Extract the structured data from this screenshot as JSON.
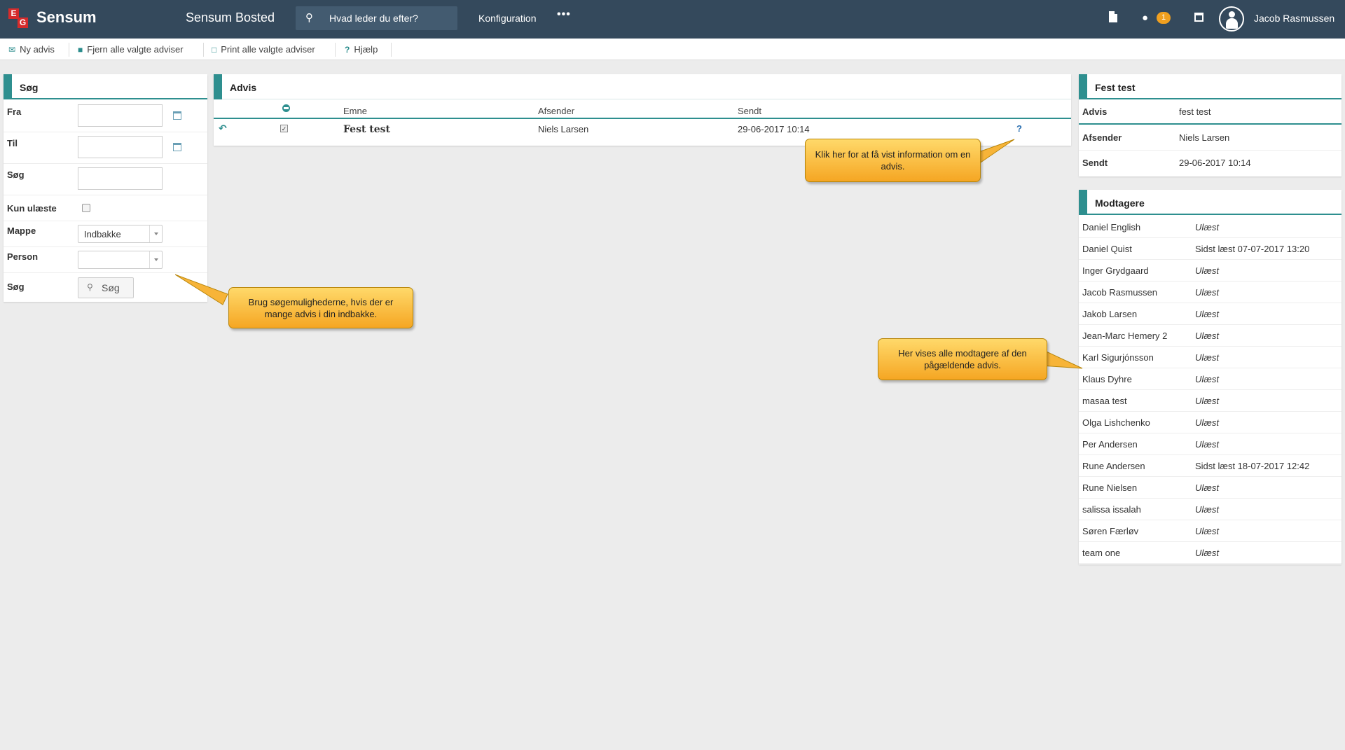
{
  "topbar": {
    "brand": "Sensum",
    "product": "Sensum Bosted",
    "search_placeholder": "Hvad leder du efter?",
    "nav_configuration": "Konfiguration",
    "nav_more": "•••",
    "chat_badge": "1",
    "user_name": "Jacob Rasmussen"
  },
  "actions": {
    "new": "Ny advis",
    "remove": "Fjern alle valgte adviser",
    "print": "Print alle valgte adviser",
    "help": "Hjælp"
  },
  "search_panel": {
    "title": "Søg",
    "from_label": "Fra",
    "to_label": "Til",
    "search_label": "Søg",
    "unread_label": "Kun ulæste",
    "folder_label": "Mappe",
    "folder_value": "Indbakke",
    "person_label": "Person",
    "person_value": "",
    "submit_label": "Søg",
    "submit_button": "Søg"
  },
  "advis_panel": {
    "title": "Advis",
    "columns": {
      "subject": "Emne",
      "sender": "Afsender",
      "sent": "Sendt"
    },
    "rows": [
      {
        "subject": "Fest test",
        "sender": "Niels Larsen",
        "sent": "29-06-2017 10:14",
        "info": "?"
      }
    ]
  },
  "detail_panel": {
    "title": "Fest test",
    "fields": [
      {
        "key": "Advis",
        "value": "fest test"
      },
      {
        "key": "Afsender",
        "value": "Niels Larsen"
      },
      {
        "key": "Sendt",
        "value": "29-06-2017 10:14"
      }
    ]
  },
  "recipients_panel": {
    "title": "Modtagere",
    "rows": [
      {
        "name": "Daniel English",
        "status": "Ulæst",
        "unread": true
      },
      {
        "name": "Daniel Quist",
        "status": "Sidst læst 07-07-2017 13:20",
        "unread": false
      },
      {
        "name": "Inger Grydgaard",
        "status": "Ulæst",
        "unread": true
      },
      {
        "name": "Jacob Rasmussen",
        "status": "Ulæst",
        "unread": true
      },
      {
        "name": "Jakob Larsen",
        "status": "Ulæst",
        "unread": true
      },
      {
        "name": "Jean-Marc Hemery 2",
        "status": "Ulæst",
        "unread": true
      },
      {
        "name": "Karl Sigurjónsson",
        "status": "Ulæst",
        "unread": true
      },
      {
        "name": "Klaus Dyhre",
        "status": "Ulæst",
        "unread": true
      },
      {
        "name": "masaa test",
        "status": "Ulæst",
        "unread": true
      },
      {
        "name": "Olga Lishchenko",
        "status": "Ulæst",
        "unread": true
      },
      {
        "name": "Per Andersen",
        "status": "Ulæst",
        "unread": true
      },
      {
        "name": "Rune Andersen",
        "status": "Sidst læst 18-07-2017 12:42",
        "unread": false
      },
      {
        "name": "Rune Nielsen",
        "status": "Ulæst",
        "unread": true
      },
      {
        "name": "salissa issalah",
        "status": "Ulæst",
        "unread": true
      },
      {
        "name": "Søren Færløv",
        "status": "Ulæst",
        "unread": true
      },
      {
        "name": "team one",
        "status": "Ulæst",
        "unread": true
      }
    ]
  },
  "tooltips": {
    "search_help": "Brug søgemulighederne, hvis der er mange advis i din indbakke.",
    "info_help": "Klik her for at få vist information om en advis.",
    "recipients_help": "Her vises alle modtagere af den pågældende advis."
  },
  "colors": {
    "topbar": "#34495c",
    "accent": "#2e8f8f",
    "tooltip": "#f5a623",
    "badge": "#f0a020"
  }
}
